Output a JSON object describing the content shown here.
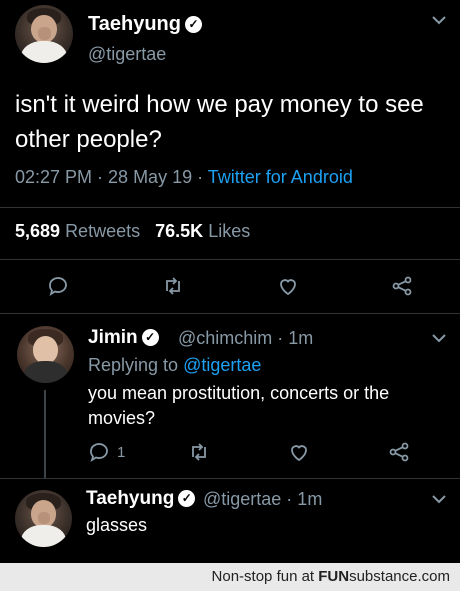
{
  "main_tweet": {
    "name": "Taehyung",
    "handle": "@tigertae",
    "text": "isn't it weird how we pay money to see other people?",
    "time": "02:27 PM · 28 May 19 ·",
    "source": "Twitter for Android",
    "retweets_count": "5,689",
    "retweets_label": "Retweets",
    "likes_count": "76.5K",
    "likes_label": "Likes"
  },
  "reply_1": {
    "name": "Jimin",
    "handle": "@chimchim · 1m",
    "replying_prefix": "Replying to",
    "replying_to": "@tigertae",
    "text": "you mean prostitution, concerts or the movies?",
    "reply_count": "1"
  },
  "reply_2": {
    "name": "Taehyung",
    "handle": "@tigertae · 1m",
    "text": "glasses"
  },
  "footer": {
    "prefix": "Non-stop fun at",
    "brand_bold": "FUN",
    "brand_light": "substance",
    "brand_suffix": ".com"
  },
  "colors": {
    "background": "#000000",
    "secondary_text": "#8899a6",
    "link": "#1da1f2"
  },
  "icons": [
    "reply-icon",
    "retweet-icon",
    "like-icon",
    "share-icon",
    "verified-icon",
    "chevron-down-icon"
  ]
}
